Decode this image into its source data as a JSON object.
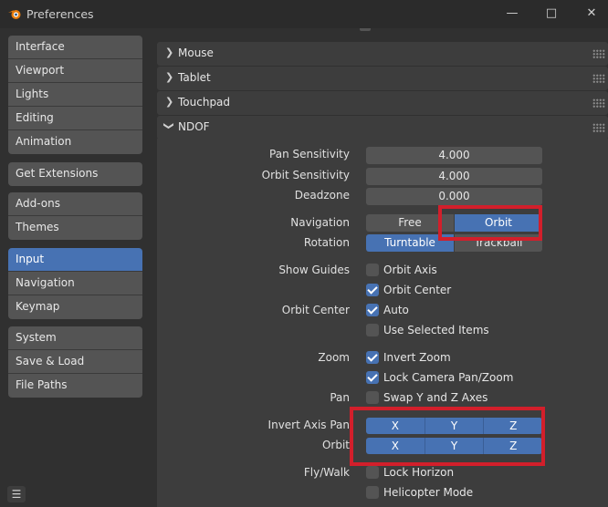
{
  "window": {
    "title": "Preferences",
    "controls": [
      "minimize-icon",
      "maximize-icon",
      "close-icon"
    ]
  },
  "sidebar": {
    "groups": [
      [
        "Interface",
        "Viewport",
        "Lights",
        "Editing",
        "Animation"
      ],
      [
        "Get Extensions"
      ],
      [
        "Add-ons",
        "Themes"
      ],
      [
        "Input",
        "Navigation",
        "Keymap"
      ],
      [
        "System",
        "Save & Load",
        "File Paths"
      ]
    ],
    "active": "Input"
  },
  "panels": {
    "mouse": "Mouse",
    "tablet": "Tablet",
    "touchpad": "Touchpad",
    "ndof": "NDOF"
  },
  "ndof": {
    "pan_sensitivity": {
      "label": "Pan Sensitivity",
      "value": "4.000"
    },
    "orbit_sensitivity": {
      "label": "Orbit Sensitivity",
      "value": "4.000"
    },
    "deadzone": {
      "label": "Deadzone",
      "value": "0.000"
    },
    "navigation": {
      "label": "Navigation",
      "options": [
        "Free",
        "Orbit"
      ],
      "selected": "Orbit"
    },
    "rotation": {
      "label": "Rotation",
      "options": [
        "Turntable",
        "Trackball"
      ],
      "selected": "Turntable"
    },
    "show_guides": {
      "label": "Show Guides",
      "orbit_axis": "Orbit Axis",
      "orbit_axis_checked": false,
      "orbit_center": "Orbit Center",
      "orbit_center_checked": true
    },
    "orbit_center": {
      "label": "Orbit Center",
      "auto": "Auto",
      "auto_checked": true,
      "use_selected": "Use Selected Items",
      "use_selected_checked": false
    },
    "zoom": {
      "label": "Zoom",
      "invert_zoom": "Invert Zoom",
      "invert_zoom_checked": true,
      "lock_camera": "Lock Camera Pan/Zoom",
      "lock_camera_checked": true
    },
    "pan": {
      "label": "Pan",
      "swap": "Swap Y and Z Axes",
      "swap_checked": false
    },
    "invert_axis_pan": {
      "label": "Invert Axis Pan",
      "axes": [
        "X",
        "Y",
        "Z"
      ]
    },
    "orbit": {
      "label": "Orbit",
      "axes": [
        "X",
        "Y",
        "Z"
      ]
    },
    "fly_walk": {
      "label": "Fly/Walk",
      "lock_horizon": "Lock Horizon",
      "lock_horizon_checked": false,
      "helicopter": "Helicopter Mode",
      "helicopter_checked": false
    }
  },
  "colors": {
    "accent": "#4772b3",
    "highlight": "#d21f2b",
    "panel": "#3d3d3d",
    "background": "#303030"
  }
}
